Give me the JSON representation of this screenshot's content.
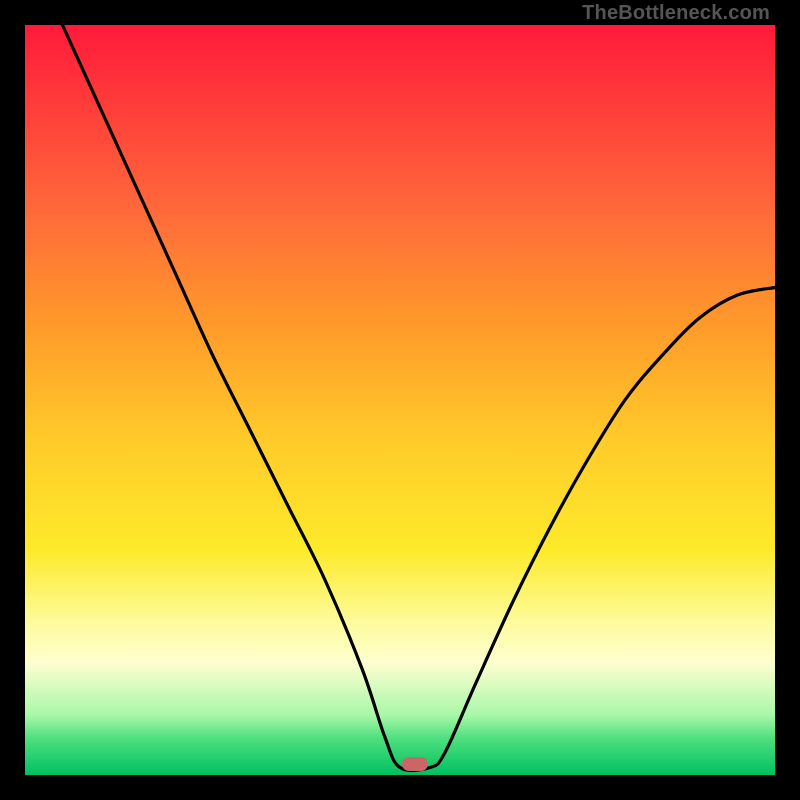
{
  "attribution": "TheBottleneck.com",
  "marker": {
    "x_pct": 52,
    "y_pct": 98.5
  },
  "chart_data": {
    "type": "line",
    "title": "",
    "xlabel": "",
    "ylabel": "",
    "xlim": [
      0,
      100
    ],
    "ylim": [
      0,
      100
    ],
    "series": [
      {
        "name": "curve",
        "x": [
          5,
          10,
          15,
          20,
          25,
          30,
          35,
          40,
          45,
          48,
          50,
          54,
          56,
          60,
          65,
          70,
          75,
          80,
          85,
          90,
          95,
          100
        ],
        "y": [
          100,
          89,
          78,
          67,
          56,
          46,
          36,
          26,
          14,
          5,
          1,
          1,
          3,
          12,
          23,
          33,
          42,
          50,
          56,
          61,
          64,
          65
        ]
      }
    ],
    "minimum_marker": {
      "x": 52,
      "y": 1
    },
    "grid": false
  },
  "colors": {
    "curve_stroke": "#000000",
    "marker_fill": "#cc6666",
    "gradient_top": "#ff1a3a",
    "gradient_bottom": "#00c060"
  }
}
